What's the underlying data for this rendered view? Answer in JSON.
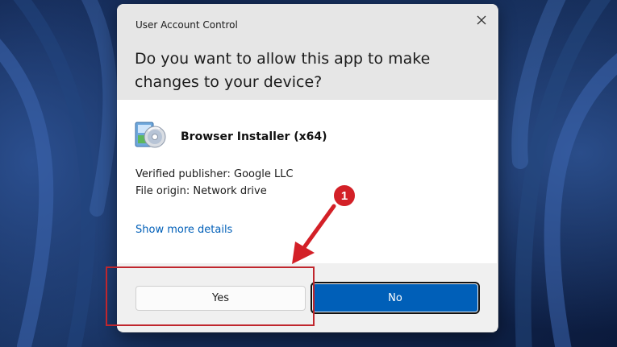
{
  "dialog": {
    "title": "User Account Control",
    "question": "Do you want to allow this app to make changes to your device?",
    "app_name": "Browser Installer (x64)",
    "publisher": "Verified publisher: Google LLC",
    "origin": "File origin: Network drive",
    "details_link": "Show more details",
    "yes_label": "Yes",
    "no_label": "No",
    "close_icon": "close-icon",
    "app_icon": "installer-disc-icon"
  },
  "annotation": {
    "step_number": "1",
    "color": "#d32027"
  },
  "colors": {
    "primary_button": "#005fb8",
    "link": "#005fb8",
    "header_bg": "#e6e6e6",
    "footer_bg": "#f0f0f0"
  }
}
